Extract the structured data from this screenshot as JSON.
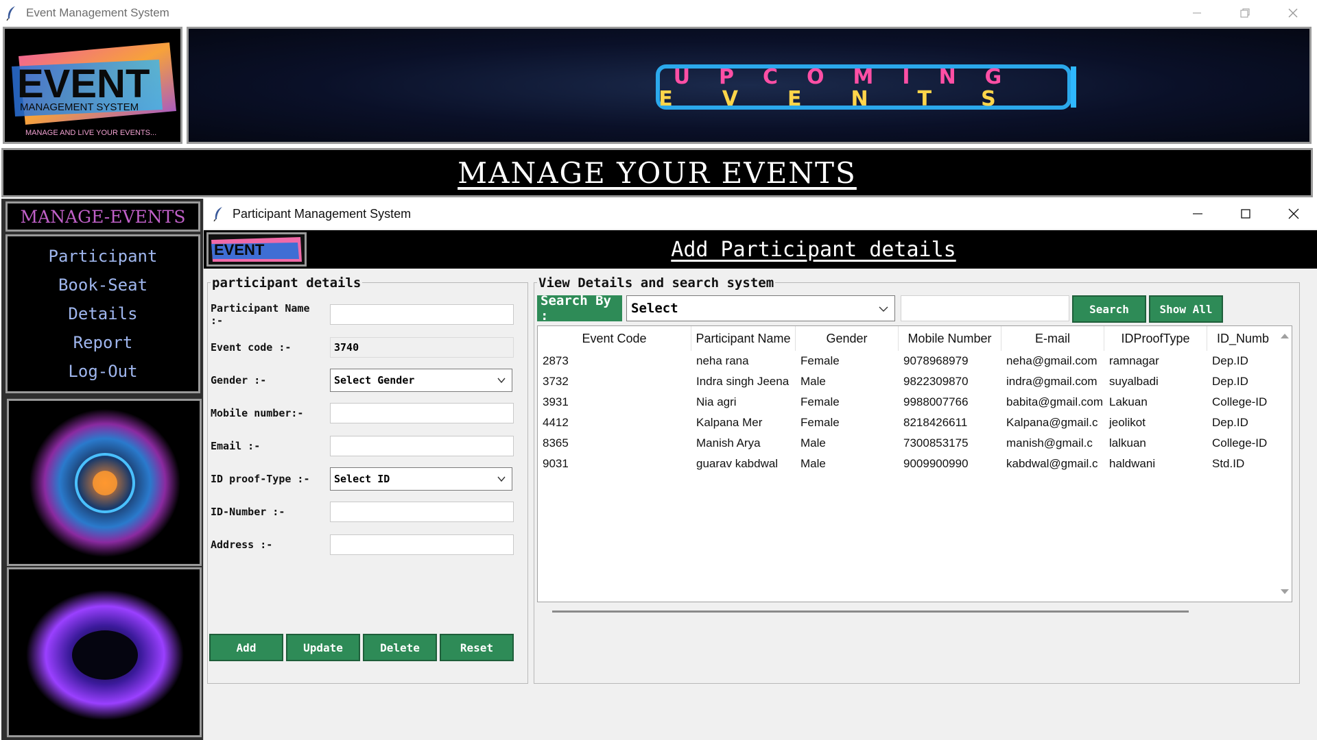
{
  "main_window": {
    "title": "Event Management System"
  },
  "logo": {
    "word": "EVENT",
    "subtitle": "MANAGEMENT SYSTEM",
    "tagline": "MANAGE AND LIVE YOUR EVENTS..."
  },
  "banner": {
    "line1": "UPCOMING",
    "line2": "EVENTS"
  },
  "manage_bar": {
    "text": "MANAGE YOUR EVENTS"
  },
  "sidebar": {
    "header": "MANAGE-EVENTS",
    "items": [
      {
        "label": "Participant"
      },
      {
        "label": "Book-Seat"
      },
      {
        "label": "Details"
      },
      {
        "label": "Report"
      },
      {
        "label": "Log-Out"
      }
    ]
  },
  "child_window": {
    "title": "Participant Management System",
    "heading": "Add Participant details"
  },
  "participant_form": {
    "frame_title": "participant details",
    "fields": {
      "name_label": "Participant Name :-",
      "name_value": "",
      "event_code_label": "Event code :-",
      "event_code_value": "3740",
      "gender_label": "Gender :-",
      "gender_value": "Select Gender",
      "mobile_label": "Mobile number:-",
      "mobile_value": "",
      "email_label": "Email :-",
      "email_value": "",
      "idtype_label": "ID proof-Type :-",
      "idtype_value": "Select ID",
      "idnumber_label": "ID-Number :-",
      "idnumber_value": "",
      "address_label": "Address :-",
      "address_value": ""
    },
    "buttons": {
      "add": "Add",
      "update": "Update",
      "delete": "Delete",
      "reset": "Reset"
    }
  },
  "view_panel": {
    "frame_title": "View Details and search system",
    "search_by_label": "Search By :",
    "search_by_value": "Select",
    "search_text": "",
    "search_button": "Search",
    "show_all_button": "Show All"
  },
  "table": {
    "columns": [
      "Event Code",
      "Participant Name",
      "Gender",
      "Mobile Number",
      "E-mail",
      "IDProofType",
      "ID_Numb"
    ],
    "rows": [
      [
        "2873",
        "neha rana",
        "Female",
        "9078968979",
        "neha@gmail.com",
        "ramnagar",
        "Dep.ID"
      ],
      [
        "3732",
        "Indra singh Jeena",
        "Male",
        "9822309870",
        "indra@gmail.com",
        "suyalbadi",
        "Dep.ID"
      ],
      [
        "3931",
        "Nia agri",
        "Female",
        "9988007766",
        "babita@gmail.com",
        "Lakuan",
        "College-ID"
      ],
      [
        "4412",
        "Kalpana Mer",
        "Female",
        "8218426611",
        "Kalpana@gmail.c",
        "jeolikot",
        "Dep.ID"
      ],
      [
        "8365",
        "Manish Arya",
        "Male",
        "7300853175",
        "manish@gmail.c",
        "lalkuan",
        "College-ID"
      ],
      [
        "9031",
        "guarav kabdwal",
        "Male",
        "9009900990",
        "kabdwal@gmail.c",
        "haldwani",
        "Std.ID"
      ]
    ]
  },
  "colors": {
    "button_green": "#2e8b57",
    "menu_text": "#9fb6ee",
    "sidebar_header_text": "#c060c8"
  }
}
